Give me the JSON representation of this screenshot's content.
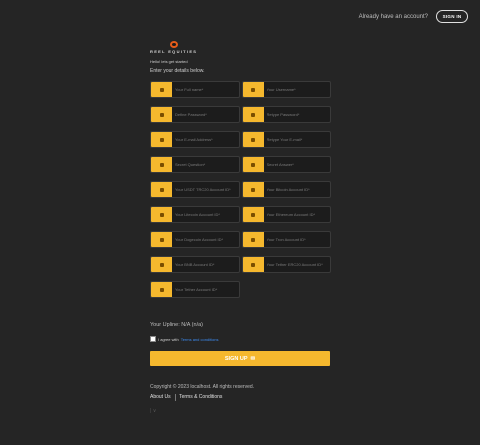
{
  "header": {
    "question": "Already have an account?",
    "signin_label": "SIGN IN"
  },
  "logo": {
    "text": "REEL EQUITIES",
    "mark_icon": "logo-mark-icon"
  },
  "greeting": "Hello! lets get started",
  "intro": "Enter your details below.",
  "fields": [
    [
      "Your Full name*",
      "Your Username*"
    ],
    [
      "Define Password*",
      "Retype Password*"
    ],
    [
      "Your E-mail Address*",
      "Retype Your E-mail*"
    ],
    [
      "Secret Question*",
      "Secret Answer*"
    ],
    [
      "Your USDT TRC20 Account ID*",
      "Your Bitcoin Account ID*"
    ],
    [
      "Your Litecoin Account ID*",
      "Your Ethereum Account ID*"
    ],
    [
      "Your Dogecoin Account ID*",
      "Your Tron Account ID*"
    ],
    [
      "Your BNB Account ID*",
      "Your Tether ERC20 Account ID*"
    ],
    [
      "Your Tether Account ID*"
    ]
  ],
  "uptime": "Your Upline: N/A (n/a)",
  "agree": {
    "text": "I agree with",
    "link": "Terms and conditions"
  },
  "signup_label": "SIGN UP",
  "footer": {
    "copyright": "Copyright © 2023 localhost. All rights reserved.",
    "about": "About Us",
    "terms": "Terms & Conditions",
    "extra": "| ∨"
  },
  "accent_color": "#f5b82e"
}
